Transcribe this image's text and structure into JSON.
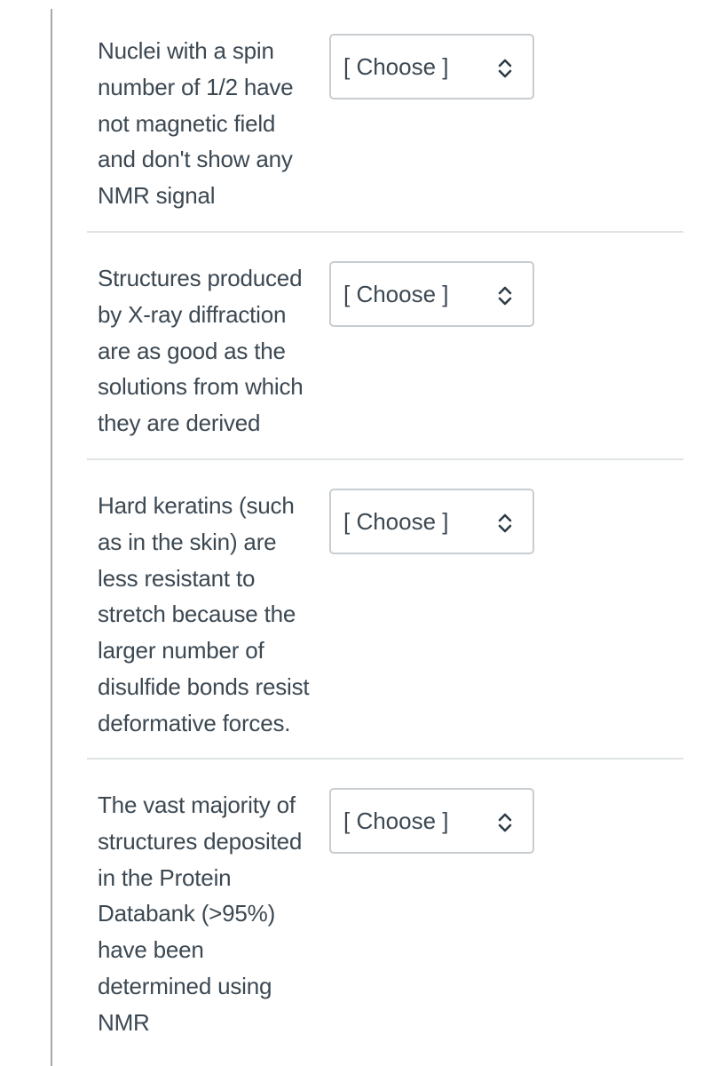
{
  "questions": [
    {
      "text": "Nuclei with a spin\nnumber of 1/2 have\nnot magnetic field\nand don't show any\nNMR signal",
      "select": {
        "value": "[ Choose ]",
        "icon": "up-down-chevron-icon"
      }
    },
    {
      "text": "Structures produced\nby X-ray diffraction\nare as good as the\nsolutions from which\nthey are derived",
      "select": {
        "value": "[ Choose ]",
        "icon": "up-down-chevron-icon"
      }
    },
    {
      "text": "Hard keratins (such\nas in the skin) are\nless resistant to\nstretch because the\nlarger number of\ndisulfide bonds resist\ndeformative forces.",
      "select": {
        "value": "[ Choose ]",
        "icon": "up-down-chevron-icon"
      }
    },
    {
      "text": "The vast majority of\nstructures deposited\nin the Protein\nDatabank (>95%)\nhave been\ndetermined using\nNMR",
      "select": {
        "value": "[ Choose ]",
        "icon": "up-down-chevron-icon"
      }
    }
  ]
}
